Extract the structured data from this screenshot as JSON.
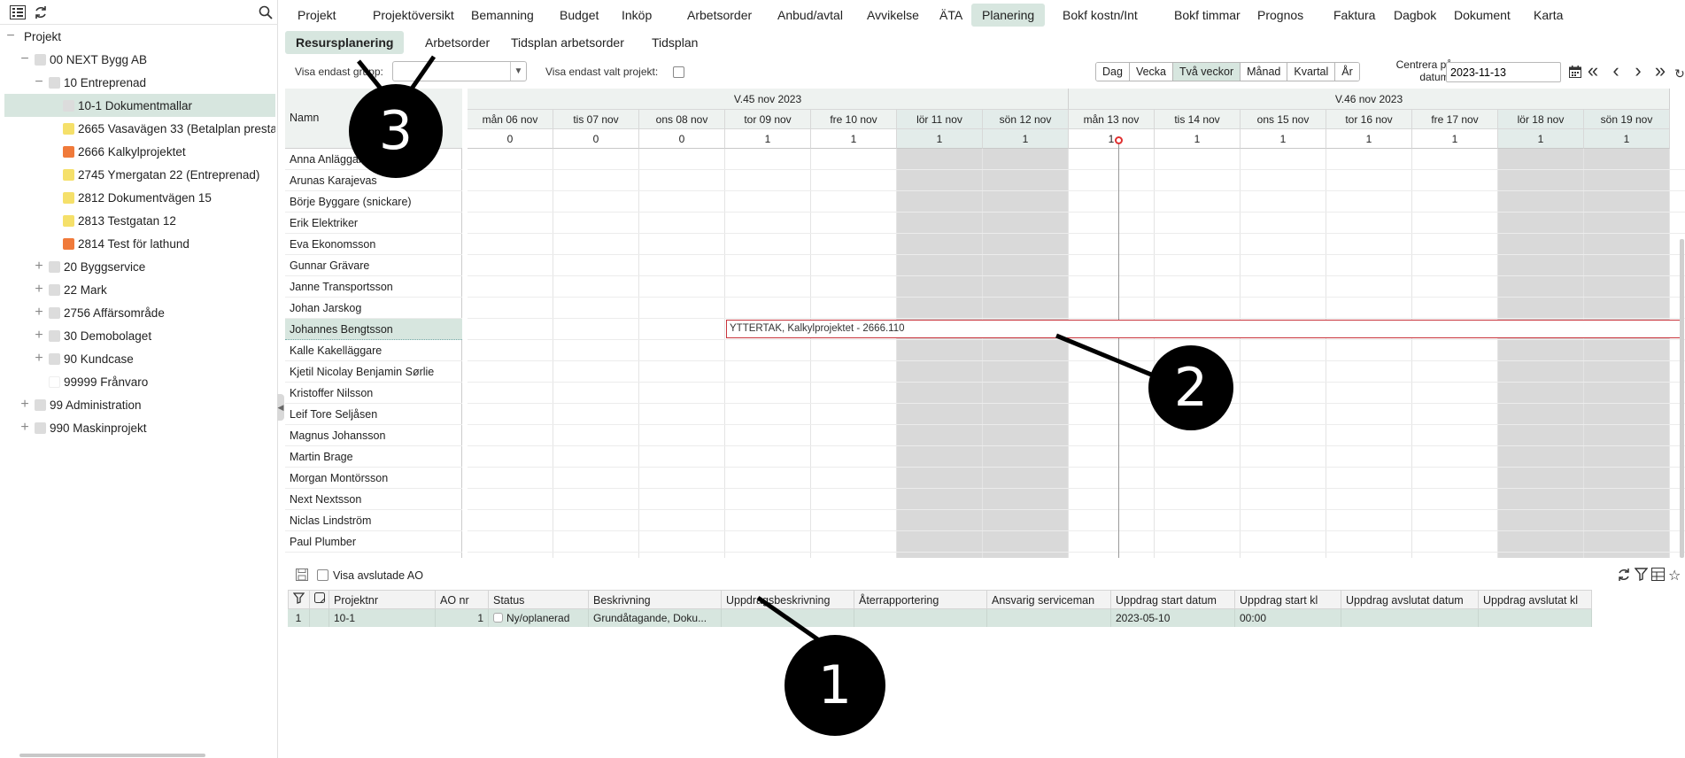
{
  "sidebar": {
    "tree": [
      {
        "label": "Projekt",
        "color": "",
        "toggle": "−"
      },
      {
        "label": "00 NEXT Bygg AB",
        "color": "#dcdcdc",
        "toggle": "−"
      },
      {
        "label": "10 Entreprenad",
        "color": "#dcdcdc",
        "toggle": "−"
      },
      {
        "label": "10-1 Dokumentmallar",
        "color": "#dcdcdc",
        "toggle": ""
      },
      {
        "label": "2665 Vasavägen 33 (Betalplan prestation)",
        "color": "#f5e06a",
        "toggle": ""
      },
      {
        "label": "2666 Kalkylprojektet",
        "color": "#f07a3a",
        "toggle": ""
      },
      {
        "label": "2745 Ymergatan 22 (Entreprenad)",
        "color": "#f5e06a",
        "toggle": ""
      },
      {
        "label": "2812 Dokumentvägen 15",
        "color": "#f5e06a",
        "toggle": ""
      },
      {
        "label": "2813 Testgatan 12",
        "color": "#f5e06a",
        "toggle": ""
      },
      {
        "label": "2814 Test för lathund",
        "color": "#f07a3a",
        "toggle": ""
      },
      {
        "label": "20 Byggservice",
        "color": "#dcdcdc",
        "toggle": "+"
      },
      {
        "label": "22 Mark",
        "color": "#dcdcdc",
        "toggle": "+"
      },
      {
        "label": "2756 Affärsområde",
        "color": "#dcdcdc",
        "toggle": "+"
      },
      {
        "label": "30 Demobolaget",
        "color": "#dcdcdc",
        "toggle": "+"
      },
      {
        "label": "90 Kundcase",
        "color": "#dcdcdc",
        "toggle": "+"
      },
      {
        "label": "99999 Frånvaro",
        "color": "#ffffff",
        "toggle": ""
      },
      {
        "label": "99 Administration",
        "color": "#dcdcdc",
        "toggle": "+"
      },
      {
        "label": "990 Maskinprojekt",
        "color": "#dcdcdc",
        "toggle": "+"
      }
    ]
  },
  "topnav": [
    "Projekt",
    "Projektöversikt",
    "Bemanning",
    "Budget",
    "Inköp",
    "Arbetsorder",
    "Anbud/avtal",
    "Avvikelse",
    "ÄTA",
    "Planering",
    "Bokf kostn/Int",
    "Bokf timmar",
    "Prognos",
    "Faktura",
    "Dagbok",
    "Dokument",
    "Karta"
  ],
  "subnav": [
    "Resursplanering",
    "Arbetsorder",
    "Tidsplan arbetsorder",
    "Tidsplan"
  ],
  "filters": {
    "group_label": "Visa endast grupp:",
    "project_only_label": "Visa endast valt projekt:",
    "views": [
      "Dag",
      "Vecka",
      "Två veckor",
      "Månad",
      "Kvartal",
      "År"
    ],
    "center_label": "Centrera på datum:",
    "date_value": "2023-11-13"
  },
  "schedule": {
    "name_header": "Namn",
    "weeks": [
      "V.45 nov 2023",
      "V.46 nov 2023"
    ],
    "days": [
      "mån 06 nov",
      "tis 07 nov",
      "ons 08 nov",
      "tor 09 nov",
      "fre 10 nov",
      "lör 11 nov",
      "sön 12 nov",
      "mån 13 nov",
      "tis 14 nov",
      "ons 15 nov",
      "tor 16 nov",
      "fre 17 nov",
      "lör 18 nov",
      "sön 19 nov"
    ],
    "weekend": [
      false,
      false,
      false,
      false,
      false,
      true,
      true,
      false,
      false,
      false,
      false,
      false,
      true,
      true
    ],
    "counts": [
      "0",
      "0",
      "0",
      "1",
      "1",
      "1",
      "1",
      "1",
      "1",
      "1",
      "1",
      "1",
      "1",
      "1"
    ],
    "people": [
      "Anna Anläggare",
      "Arunas Karajevas",
      "Börje Byggare (snickare)",
      "Erik Elektriker",
      "Eva Ekonomsson",
      "Gunnar Grävare",
      "Janne Transportsson",
      "Johan Jarskog",
      "Johannes Bengtsson",
      "Kalle Kakelläggare",
      "Kjetil Nicolay Benjamin Sørlie",
      "Kristoffer Nilsson",
      "Leif Tore Seljåsen",
      "Magnus Johansson",
      "Martin Brage",
      "Morgan Montörsson",
      "Next Nextsson",
      "Niclas Lindström",
      "Paul Plumber"
    ],
    "booking": {
      "label": "YTTERTAK, Kalkylprojektet - 2666.110"
    }
  },
  "lower": {
    "show_closed_label": "Visa avslutade AO",
    "columns": [
      "Projektnr",
      "AO nr",
      "Status",
      "Beskrivning",
      "Uppdragsbeskrivning",
      "Återrapportering",
      "Ansvarig serviceman",
      "Uppdrag start datum",
      "Uppdrag start kl",
      "Uppdrag avslutat datum",
      "Uppdrag avslutat kl"
    ],
    "row": {
      "index": "1",
      "projektnr": "10-1",
      "ao_nr": "1",
      "status": "Ny/oplanerad",
      "beskrivning": "Grundåtagande, Doku...",
      "start_datum": "2023-05-10",
      "start_kl": "00:00"
    }
  },
  "callouts": [
    "1",
    "2",
    "3"
  ],
  "colors": {
    "accent": "#d7e6df",
    "booking_border": "#c8333b",
    "today_marker": "#e03030"
  }
}
